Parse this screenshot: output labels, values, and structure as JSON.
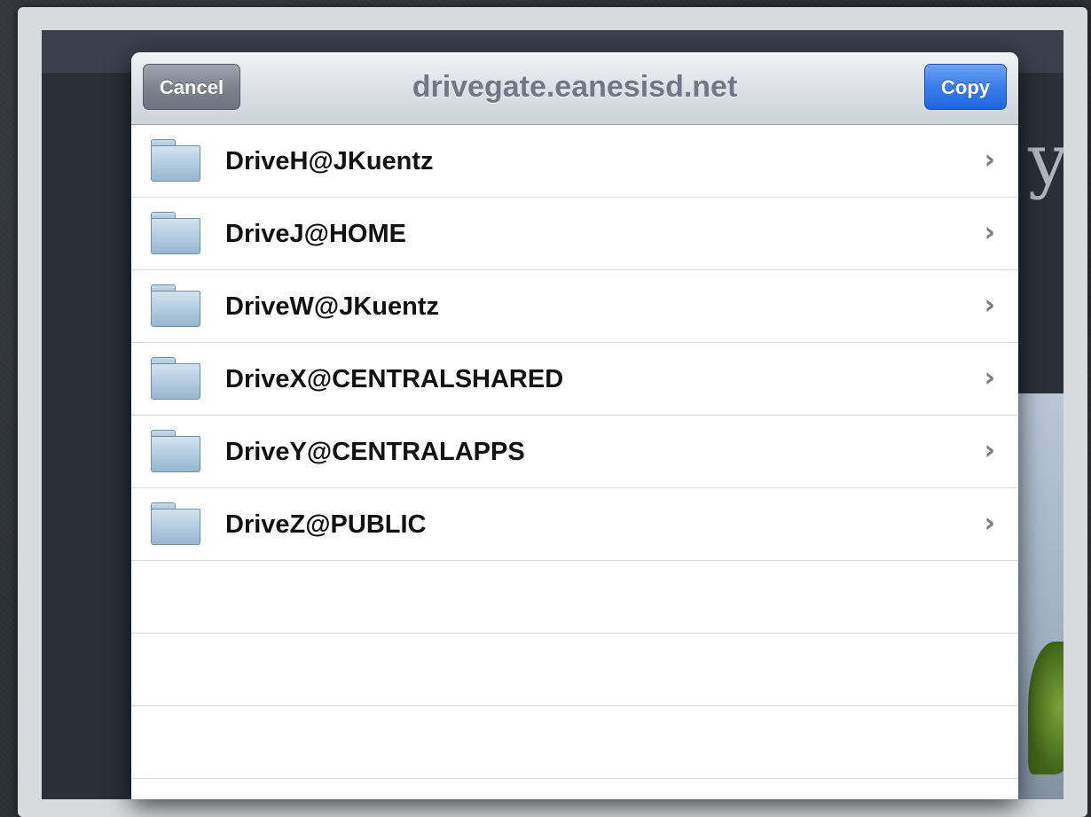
{
  "navbar": {
    "title": "drivegate.eanesisd.net",
    "cancel_label": "Cancel",
    "copy_label": "Copy"
  },
  "folders": [
    {
      "label": "DriveH@JKuentz"
    },
    {
      "label": "DriveJ@HOME"
    },
    {
      "label": "DriveW@JKuentz"
    },
    {
      "label": "DriveX@CENTRALSHARED"
    },
    {
      "label": "DriveY@CENTRALAPPS"
    },
    {
      "label": "DriveZ@PUBLIC"
    }
  ],
  "icons": {
    "folder": "folder-icon",
    "chevron": "chevron-right-icon"
  },
  "colors": {
    "copy_button": "#3a7cea",
    "cancel_button": "#7c848e",
    "title_text": "#6f7884"
  }
}
